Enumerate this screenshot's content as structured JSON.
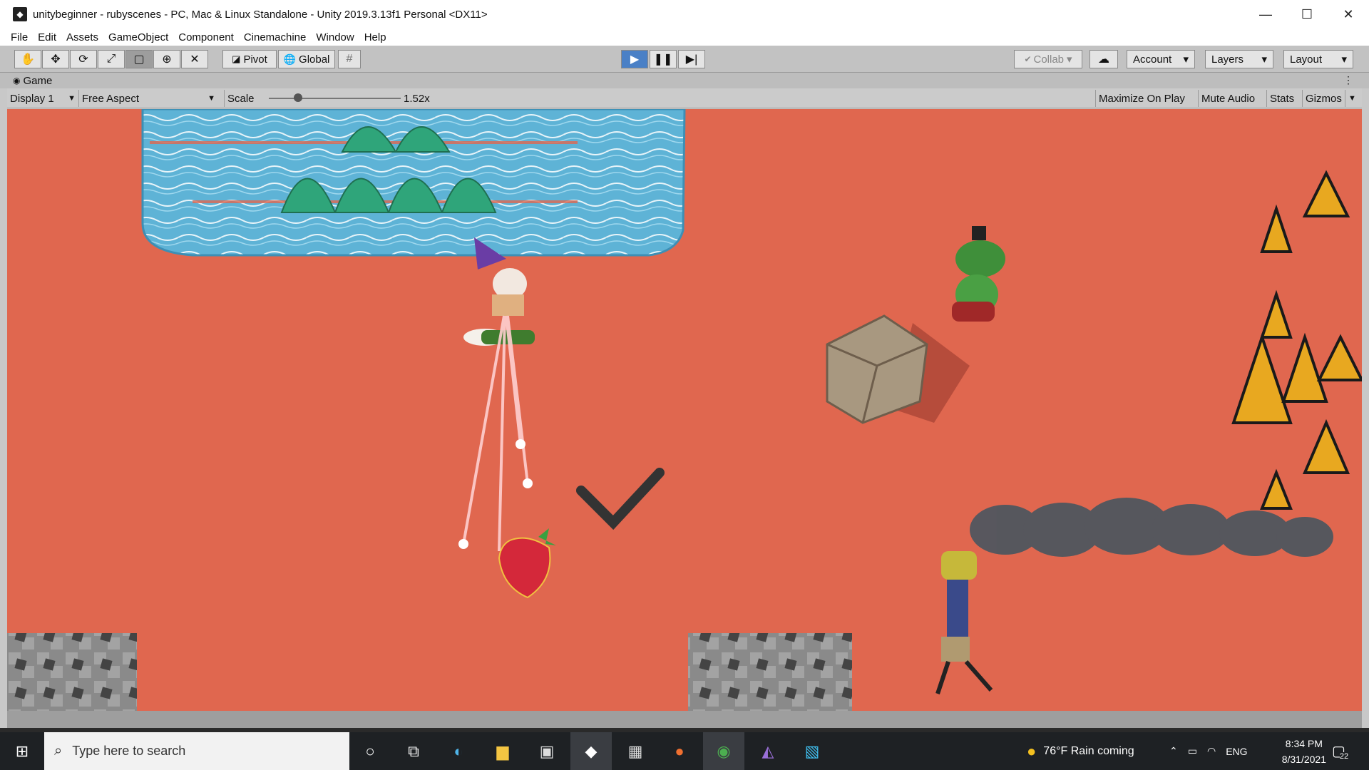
{
  "window": {
    "title": "unitybeginner - rubyscenes - PC, Mac & Linux Standalone - Unity 2019.3.13f1 Personal <DX11>",
    "controls": [
      "—",
      "☐",
      "✕"
    ]
  },
  "menu": [
    "File",
    "Edit",
    "Assets",
    "GameObject",
    "Component",
    "Cinemachine",
    "Window",
    "Help"
  ],
  "toolbar": {
    "pivot_label": "Pivot",
    "global_label": "Global",
    "collab_label": "Collab",
    "account_label": "Account",
    "layers_label": "Layers",
    "layout_label": "Layout",
    "arrow": "▾"
  },
  "game_tab": {
    "tab_label": "Game",
    "display_label": "Display 1",
    "aspect_label": "Free Aspect",
    "scale_label": "Scale",
    "scale_value": "1.52x",
    "maximize_label": "Maximize On Play",
    "mute_label": "Mute Audio",
    "stats_label": "Stats",
    "gizmos_label": "Gizmos"
  },
  "taskbar": {
    "search_placeholder": "Type here to search",
    "weather": "76°F  Rain coming",
    "language": "ENG",
    "time": "8:34 PM",
    "date": "8/31/2021",
    "notifications": "22"
  },
  "colors": {
    "ground": "#e0674f",
    "water": "#5eb3d6",
    "accent_play": "#4a80c6"
  }
}
